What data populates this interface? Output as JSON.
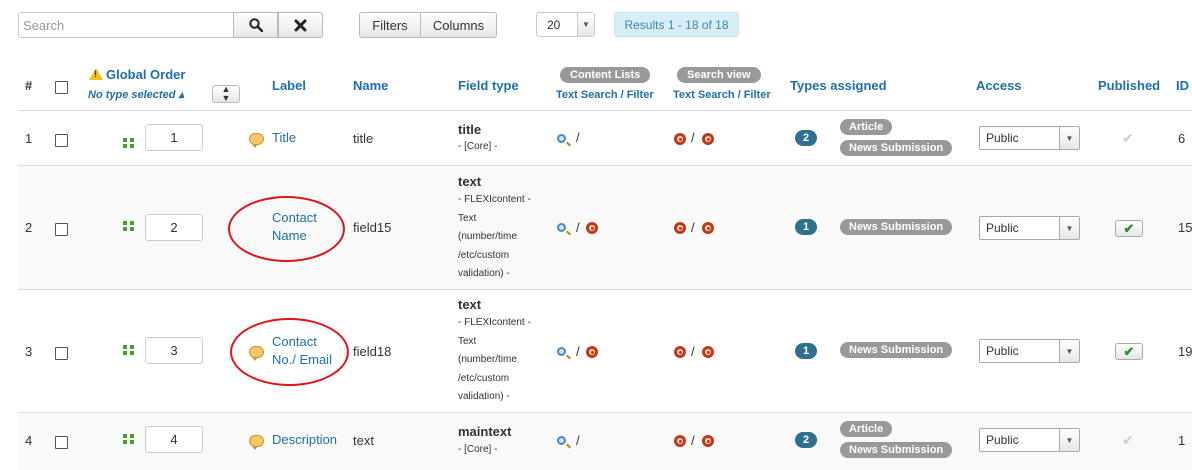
{
  "toolbar": {
    "search_placeholder": "Search",
    "filters_label": "Filters",
    "columns_label": "Columns",
    "limit_value": "20",
    "results_text": "Results 1 - 18 of 18"
  },
  "table_header": {
    "hash": "#",
    "global_order": "Global Order",
    "no_type_selected": "No type selected ▴",
    "label": "Label",
    "name": "Name",
    "field_type": "Field type",
    "content_lists": "Content Lists",
    "search_view": "Search view",
    "text_search_filter": "Text Search / Filter",
    "types_assigned": "Types assigned",
    "access": "Access",
    "published": "Published",
    "id": "ID"
  },
  "rows": [
    {
      "num": "1",
      "order": "1",
      "label": "Title",
      "name": "title",
      "ftype": "title",
      "ftype_sub": "- [Core] -",
      "types_count": "2",
      "types": [
        "Article",
        "News Submission"
      ],
      "access": "Public",
      "published": false,
      "id": "6"
    },
    {
      "num": "2",
      "order": "2",
      "label": "Contact Name",
      "name": "field15",
      "ftype": "text",
      "ftype_sub": "- FLEXIcontent - Text (number/time /etc/custom validation) -",
      "types_count": "1",
      "types": [
        "News Submission"
      ],
      "access": "Public",
      "published": true,
      "id": "15"
    },
    {
      "num": "3",
      "order": "3",
      "label": "Contact No./ Email",
      "name": "field18",
      "ftype": "text",
      "ftype_sub": "- FLEXIcontent - Text (number/time /etc/custom validation) -",
      "types_count": "1",
      "types": [
        "News Submission"
      ],
      "access": "Public",
      "published": true,
      "id": "19"
    },
    {
      "num": "4",
      "order": "4",
      "label": "Description",
      "name": "text",
      "ftype": "maintext",
      "ftype_sub": "- [Core] -",
      "types_count": "2",
      "types": [
        "Article",
        "News Submission"
      ],
      "access": "Public",
      "published": false,
      "id": "1"
    }
  ],
  "row_text": {
    "r1_label": "Title",
    "r2_label_1": "Contact",
    "r2_label_2": "Name",
    "r3_label_1": "Contact",
    "r3_label_2": "No./ Email",
    "r4_label": "Description",
    "sub_core": "- [Core] -",
    "sub_flexi_1": "- FLEXIcontent -",
    "sub_flexi_2": "Text",
    "sub_flexi_3": "(number/time",
    "sub_flexi_4": "/etc/custom",
    "sub_flexi_5": "validation) -",
    "slash": "/",
    "check_mark": "✔",
    "check_off": "✔",
    "id_2": "15",
    "id_3": "19"
  },
  "icons": {
    "search": "search-icon",
    "clear": "close-icon",
    "warning": "warning-icon",
    "drag": "drag-handle-icon",
    "comment": "comment-icon",
    "magnifier": "magnifier-icon",
    "radio": "radio-icon"
  },
  "colors": {
    "link": "#1f6fa8",
    "badge_bg": "#2f6f8f",
    "tag_bg": "#999999",
    "radio": "#c0391b",
    "annotation": "#e0141b",
    "published": "#2e8b2e"
  }
}
